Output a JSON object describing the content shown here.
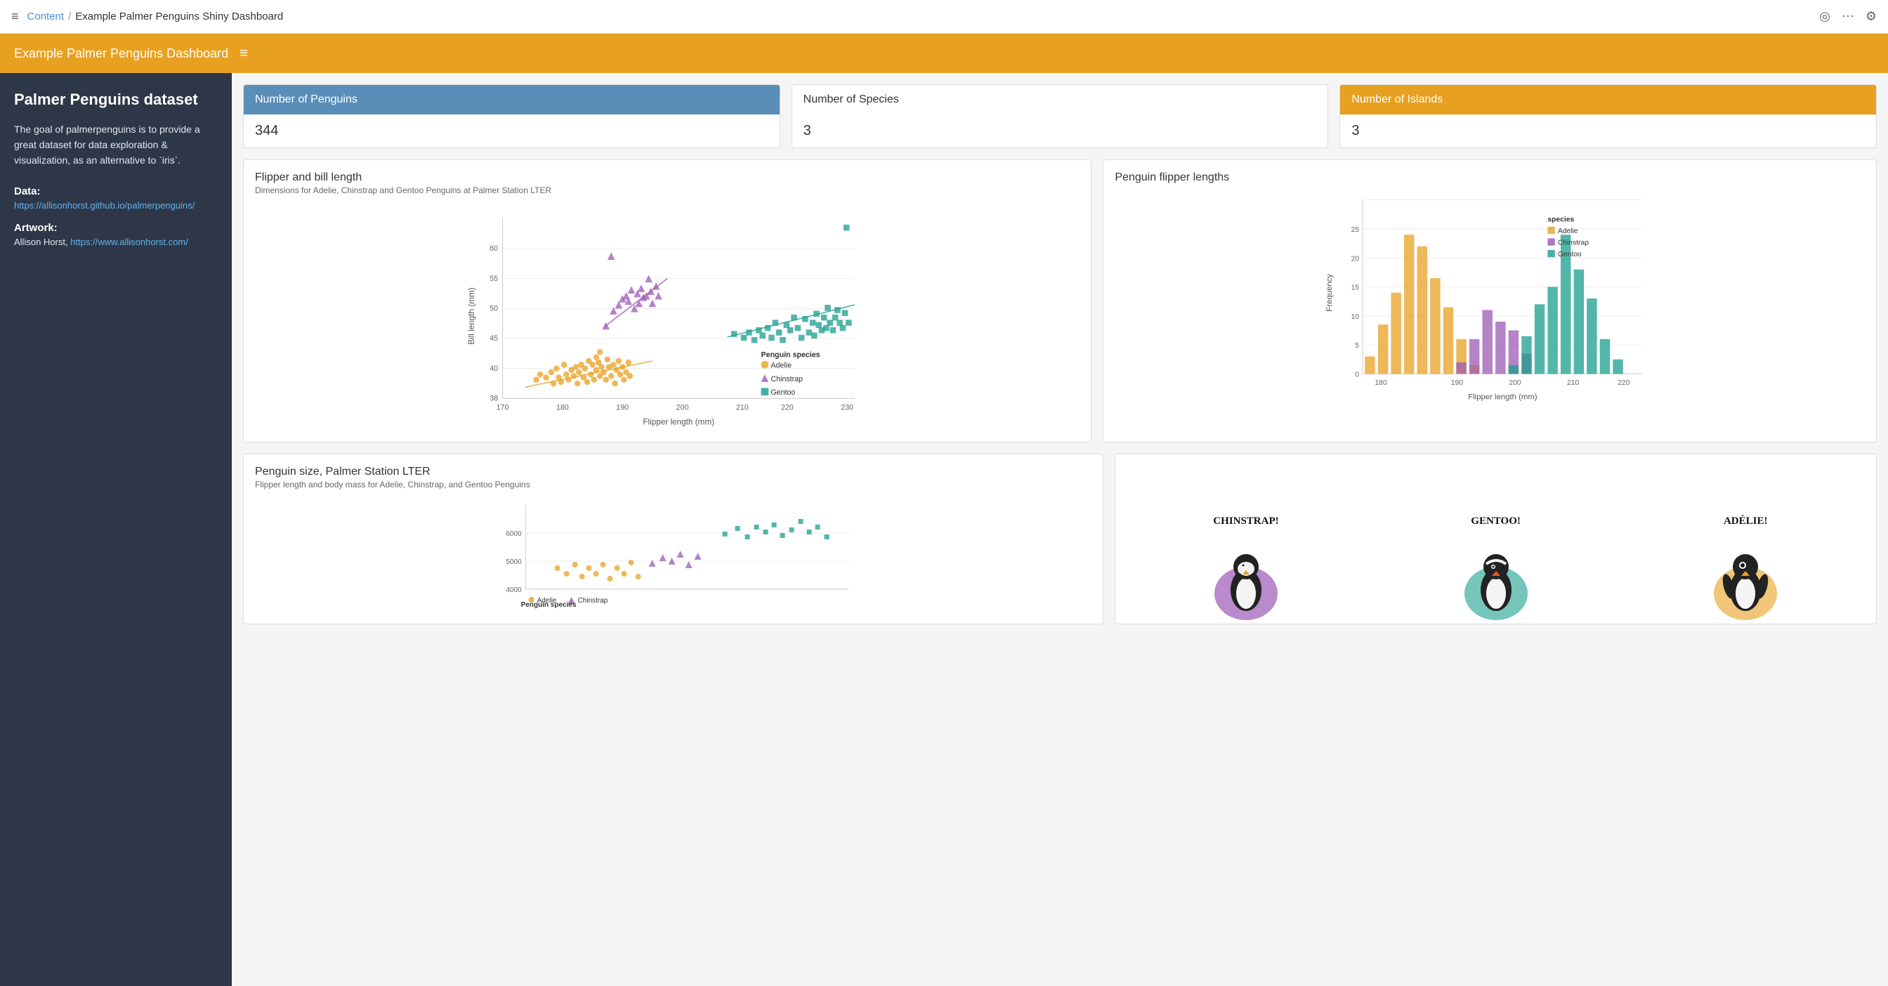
{
  "topbar": {
    "hamburger_label": "≡",
    "breadcrumb_link": "Content",
    "breadcrumb_sep": "/",
    "breadcrumb_current": "Example Palmer Penguins Shiny Dashboard",
    "icons": {
      "target": "◎",
      "dots": "⋯",
      "gear": "⚙"
    }
  },
  "appbar": {
    "title": "Example Palmer Penguins Dashboard",
    "menu_icon": "≡"
  },
  "sidebar": {
    "title": "Palmer Penguins dataset",
    "description": "The goal of palmerpenguins is to provide a great dataset for data exploration & visualization, as an alternative to `iris`.",
    "data_label": "Data:",
    "data_link": "https://allisonhorst.github.io/palmerpenguins/",
    "artwork_label": "Artwork:",
    "artwork_text": "Allison Horst,",
    "artwork_link": "https://www.allisonhorst.com/"
  },
  "stat_cards": [
    {
      "id": "penguins",
      "header": "Number of Penguins",
      "value": "344",
      "header_style": "blue"
    },
    {
      "id": "species",
      "header": "Number of Species",
      "value": "3",
      "header_style": "white"
    },
    {
      "id": "islands",
      "header": "Number of Islands",
      "value": "3",
      "header_style": "orange"
    }
  ],
  "scatter_chart": {
    "title": "Flipper and bill length",
    "subtitle": "Dimensions for Adelie, Chinstrap and Gentoo Penguins at Palmer Station LTER",
    "x_label": "Flipper length (mm)",
    "y_label": "Bill length (mm)",
    "legend": {
      "title": "Penguin species",
      "items": [
        "Adelie",
        "Chinstrap",
        "Gentoo"
      ]
    }
  },
  "histogram_chart": {
    "title": "Penguin flipper lengths",
    "x_label": "Flipper length (mm)",
    "y_label": "Frequency",
    "legend": {
      "title": "species",
      "items": [
        "Adelie",
        "Chinstrap",
        "Gentoo"
      ]
    }
  },
  "bottom_scatter": {
    "title": "Penguin size, Palmer Station LTER",
    "subtitle": "Flipper length and body mass for Adelie, Chinstrap, and Gentoo Penguins",
    "legend": {
      "title": "Penguin species",
      "items": [
        "Adelie",
        "Chinstrap"
      ]
    },
    "y_label": "5000"
  },
  "penguin_art": {
    "labels": [
      "CHINSTRAP!",
      "GENTOO!",
      "ADÉLIE!"
    ],
    "colors": [
      "#9b59b6",
      "#1a9e8e",
      "#e8a020"
    ]
  },
  "colors": {
    "adelie": "#e8a020",
    "chinstrap": "#9b59b6",
    "gentoo": "#1a9e8e",
    "orange_accent": "#e8a020",
    "blue_accent": "#5a8eb8"
  }
}
